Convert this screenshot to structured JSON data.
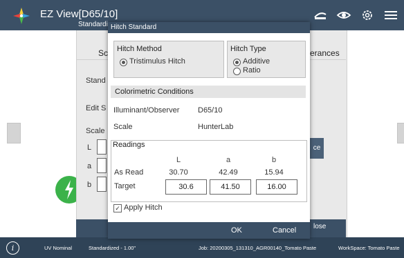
{
  "app": {
    "title": "EZ View[D65/10]",
    "subtitle": "Standardize",
    "icons": [
      "wifi-sensor-icon",
      "eye-icon",
      "gear-icon",
      "menu-icon"
    ]
  },
  "background": {
    "tab_left": "Sc",
    "tab_right": "erances",
    "label1": "Stand",
    "label2": "Edit S",
    "label3": "Scale",
    "row_l": "L",
    "row_a": "a",
    "row_b": "b",
    "side_button": "ce",
    "close_label": "lose"
  },
  "status": {
    "uv": "UV Nominal",
    "standardized": "Standardized - 1.00\"",
    "job": "Job: 20200305_131310_AGR00140_Tomato Paste",
    "workspace": "WorkSpace: Tomato Paste"
  },
  "dialog": {
    "title": "Hitch Standard",
    "hitch_method": {
      "title": "Hitch Method",
      "option": "Tristimulus Hitch"
    },
    "hitch_type": {
      "title": "Hitch Type",
      "options": [
        "Additive",
        "Ratio"
      ],
      "selected": "Additive"
    },
    "colorimetric": {
      "title": "Colorimetric Conditions",
      "illuminant_label": "Illuminant/Observer",
      "illuminant_value": "D65/10",
      "scale_label": "Scale",
      "scale_value": "HunterLab"
    },
    "readings": {
      "title": "Readings",
      "headers": [
        "L",
        "a",
        "b"
      ],
      "as_read_label": "As Read",
      "as_read": [
        "30.70",
        "42.49",
        "15.94"
      ],
      "target_label": "Target",
      "target": [
        "30.6",
        "41.50",
        "16.00"
      ]
    },
    "apply_hitch": {
      "label": "Apply Hitch",
      "checked": true
    },
    "buttons": {
      "ok": "OK",
      "cancel": "Cancel"
    }
  }
}
